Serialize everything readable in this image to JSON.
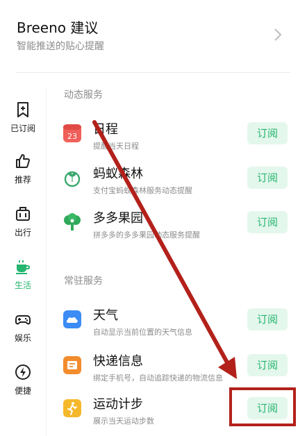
{
  "header": {
    "title": "Breeno 建议",
    "subtitle": "智能推送的贴心提醒",
    "chevron_icon": "chevron-right-icon"
  },
  "sidebar": {
    "items": [
      {
        "label": "已订阅",
        "icon": "bookmark-plus-icon",
        "active": false
      },
      {
        "label": "推荐",
        "icon": "thumbs-up-icon",
        "active": false
      },
      {
        "label": "出行",
        "icon": "luggage-icon",
        "active": false
      },
      {
        "label": "生活",
        "icon": "coffee-cup-icon",
        "active": true
      },
      {
        "label": "娱乐",
        "icon": "gamepad-icon",
        "active": false
      },
      {
        "label": "便捷",
        "icon": "lightning-icon",
        "active": false
      }
    ]
  },
  "sections": [
    {
      "title": "动态服务",
      "services": [
        {
          "name": "日程",
          "desc": "提醒当天日程",
          "icon": "calendar-icon",
          "icon_text": "23",
          "button": "订阅"
        },
        {
          "name": "蚂蚁森林",
          "desc": "支付宝蚂蚁森林服务动态提醒",
          "icon": "sprout-icon",
          "button": "订阅"
        },
        {
          "name": "多多果园",
          "desc": "拼多多的多多果园动态服务提醒",
          "icon": "tree-icon",
          "button": "订阅"
        }
      ]
    },
    {
      "title": "常驻服务",
      "services": [
        {
          "name": "天气",
          "desc": "自动显示当前位置的天气信息",
          "icon": "weather-cloud-icon",
          "button": "订阅"
        },
        {
          "name": "快递信息",
          "desc": "绑定手机号，自动追踪快递的物流信息",
          "icon": "package-icon",
          "button": "订阅"
        },
        {
          "name": "运动计步",
          "desc": "展示当天运动步数",
          "icon": "running-icon",
          "button": "订阅"
        }
      ]
    }
  ],
  "colors": {
    "accent": "#24b56e",
    "button_bg": "#e4f7ec",
    "annotation": "#b3211b"
  }
}
